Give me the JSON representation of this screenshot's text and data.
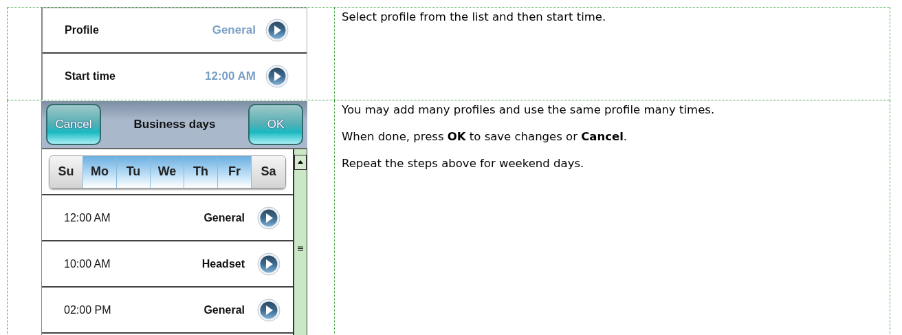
{
  "rows": [
    {
      "settings": [
        {
          "label": "Profile",
          "value": "General"
        },
        {
          "label": "Start time",
          "value": "12:00 AM"
        }
      ],
      "paragraphs": [
        "Select profile from the list and then start time."
      ]
    },
    {
      "editor": {
        "cancel": "Cancel",
        "title": "Business days",
        "ok": "OK",
        "days": [
          {
            "label": "Su",
            "selected": false
          },
          {
            "label": "Mo",
            "selected": true
          },
          {
            "label": "Tu",
            "selected": true
          },
          {
            "label": "We",
            "selected": true
          },
          {
            "label": "Th",
            "selected": true
          },
          {
            "label": "Fr",
            "selected": true
          },
          {
            "label": "Sa",
            "selected": false
          }
        ],
        "entries": [
          {
            "time": "12:00 AM",
            "profile": "General"
          },
          {
            "time": "10:00 AM",
            "profile": "Headset"
          },
          {
            "time": "02:00 PM",
            "profile": "General"
          }
        ]
      },
      "paragraphs": [
        "You may add many profiles and use the same profile many times.",
        "When done, press **OK** to save changes or **Cancel**.",
        "Repeat the steps above for weekend days."
      ]
    }
  ]
}
